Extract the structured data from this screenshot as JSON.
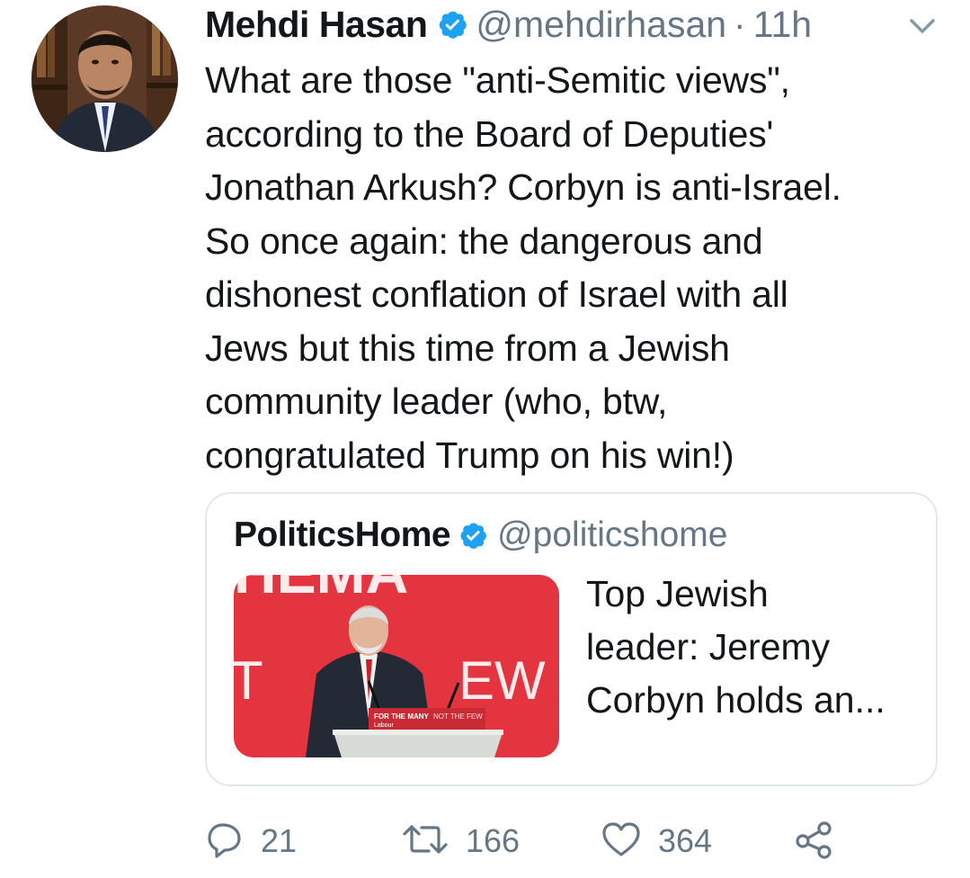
{
  "tweet": {
    "author_name": "Mehdi Hasan",
    "handle": "@mehdirhasan",
    "separator": "·",
    "time": "11h",
    "text": "What are those \"anti-Semitic views\",\naccording to the Board of Deputies'\nJonathan Arkush? Corbyn is anti-Israel.\nSo once again: the dangerous and\ndishonest conflation of Israel with all\nJews but this time from a Jewish\ncommunity leader (who, btw,\ncongratulated Trump on his win!)"
  },
  "quoted": {
    "author_name": "PoliticsHome",
    "handle": "@politicshome",
    "summary": "Top Jewish\nleader: Jeremy\nCorbyn holds an...",
    "image": {
      "backdrop_text_top": "HEMA",
      "backdrop_text_mid_left": "T",
      "backdrop_text_mid_right": "EW",
      "podium_text_bold": "FOR THE MANY",
      "podium_text_light": "NOT THE FEW",
      "podium_logo": "Labour"
    }
  },
  "actions": {
    "reply_count": "21",
    "retweet_count": "166",
    "like_count": "364"
  },
  "icons": {
    "verified": "verified-badge-icon",
    "chevron": "chevron-down-icon",
    "reply": "reply-icon",
    "retweet": "retweet-icon",
    "like": "heart-icon",
    "share": "share-icon"
  },
  "colors": {
    "text_primary": "#14171a",
    "text_secondary": "#657786",
    "verified_blue": "#1da1f2",
    "border": "#e1e8ed",
    "labour_red": "#e4343f"
  }
}
